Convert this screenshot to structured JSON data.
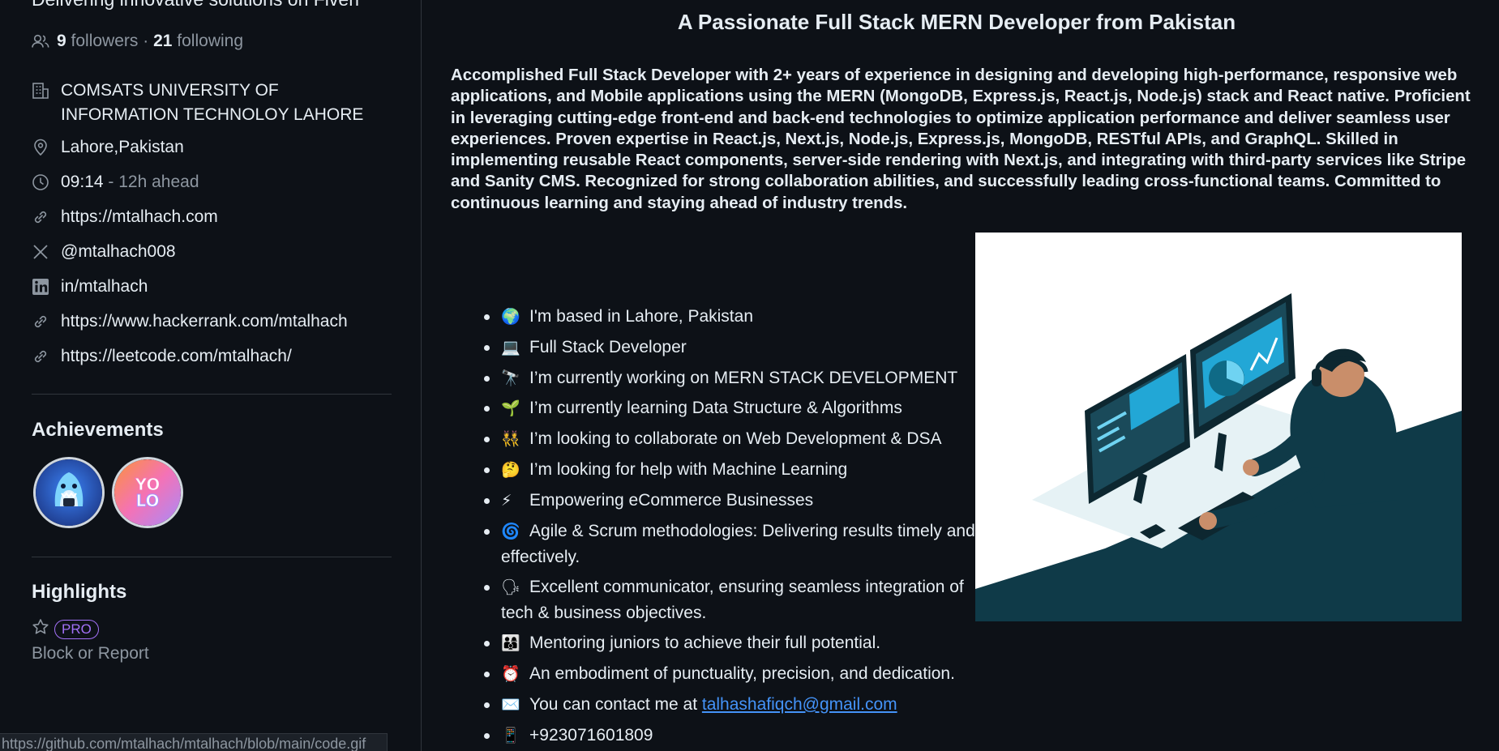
{
  "sidebar": {
    "bio": "Delivering innovative solutions on Fiverr",
    "followers_count": "9",
    "followers_label": "followers",
    "separator": "·",
    "following_count": "21",
    "following_label": "following",
    "organization": "COMSATS UNIVERSITY OF INFORMATION TECHNOLOY LAHORE",
    "location": "Lahore,Pakistan",
    "local_time": "09:14",
    "time_offset": "- 12h ahead",
    "website": "https://mtalhach.com",
    "twitter": "@mtalhach008",
    "linkedin": "in/mtalhach",
    "link_hackerrank": "https://www.hackerrank.com/mtalhach",
    "link_leetcode": "https://leetcode.com/mtalhach/",
    "achievements_title": "Achievements",
    "highlights_title": "Highlights",
    "pro_label": "PRO",
    "block_report": "Block or Report"
  },
  "statusbar": {
    "url": "https://github.com/mtalhach/mtalhach/blob/main/code.gif"
  },
  "readme": {
    "headline": "A Passionate Full Stack MERN Developer from Pakistan",
    "summary": "Accomplished Full Stack Developer with 2+ years of experience in designing and developing high-performance, responsive web applications, and Mobile applications using the MERN (MongoDB, Express.js, React.js, Node.js) stack and React native. Proficient in leveraging cutting-edge front-end and back-end technologies to optimize application performance and deliver seamless user experiences. Proven expertise in React.js, Next.js, Node.js, Express.js, MongoDB, RESTful APIs, and GraphQL. Skilled in implementing reusable React components, server-side rendering with Next.js, and integrating with third-party services like Stripe and Sanity CMS. Recognized for strong collaboration abilities, and successfully leading cross-functional teams. Committed to continuous learning and staying ahead of industry trends.",
    "items": [
      {
        "emoji": "🌍",
        "text": "I'm based in Lahore, Pakistan"
      },
      {
        "emoji": "💻",
        "text": "Full Stack Developer"
      },
      {
        "emoji": "🔭",
        "text": "I’m currently working on MERN STACK DEVELOPMENT"
      },
      {
        "emoji": "🌱",
        "text": "I’m currently learning Data Structure & Algorithms"
      },
      {
        "emoji": "👯",
        "text": "I’m looking to collaborate on Web Development & DSA"
      },
      {
        "emoji": "🤔",
        "text": "I’m looking for help with Machine Learning"
      },
      {
        "emoji": "⚡",
        "text": "Empowering eCommerce Businesses"
      },
      {
        "emoji": "🌀",
        "text": "Agile & Scrum methodologies: Delivering results timely and effectively."
      },
      {
        "emoji": "🗣",
        "text": "Excellent communicator, ensuring seamless integration of tech & business objectives."
      },
      {
        "emoji": "👨‍👩‍👦",
        "text": "Mentoring juniors to achieve their full potential."
      },
      {
        "emoji": "⏰",
        "text": "An embodiment of punctuality, precision, and dedication."
      },
      {
        "emoji": "✉️",
        "text": "You can contact me at",
        "link": "talhashafiqch@gmail.com"
      },
      {
        "emoji": "📱",
        "text": "+923071601809"
      }
    ]
  }
}
